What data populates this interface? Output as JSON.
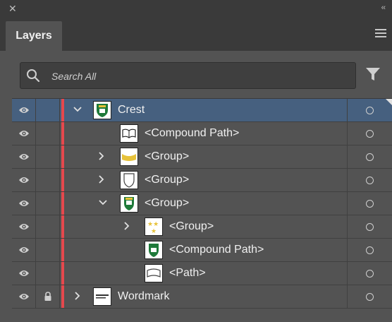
{
  "panel": {
    "tab_label": "Layers",
    "search_placeholder": "Search All"
  },
  "colors": {
    "layer_color": "#e5484d",
    "selection": "#46607f"
  },
  "rows": [
    {
      "label": "Crest",
      "thumb": "crest"
    },
    {
      "label": "<Compound Path>",
      "thumb": "book"
    },
    {
      "label": "<Group>",
      "thumb": "ribbon"
    },
    {
      "label": "<Group>",
      "thumb": "shield-outline"
    },
    {
      "label": "<Group>",
      "thumb": "green-shield"
    },
    {
      "label": "<Group>",
      "thumb": "stars"
    },
    {
      "label": "<Compound Path>",
      "thumb": "green-shield"
    },
    {
      "label": "<Path>",
      "thumb": "path"
    },
    {
      "label": "Wordmark",
      "thumb": "wordmark"
    }
  ]
}
